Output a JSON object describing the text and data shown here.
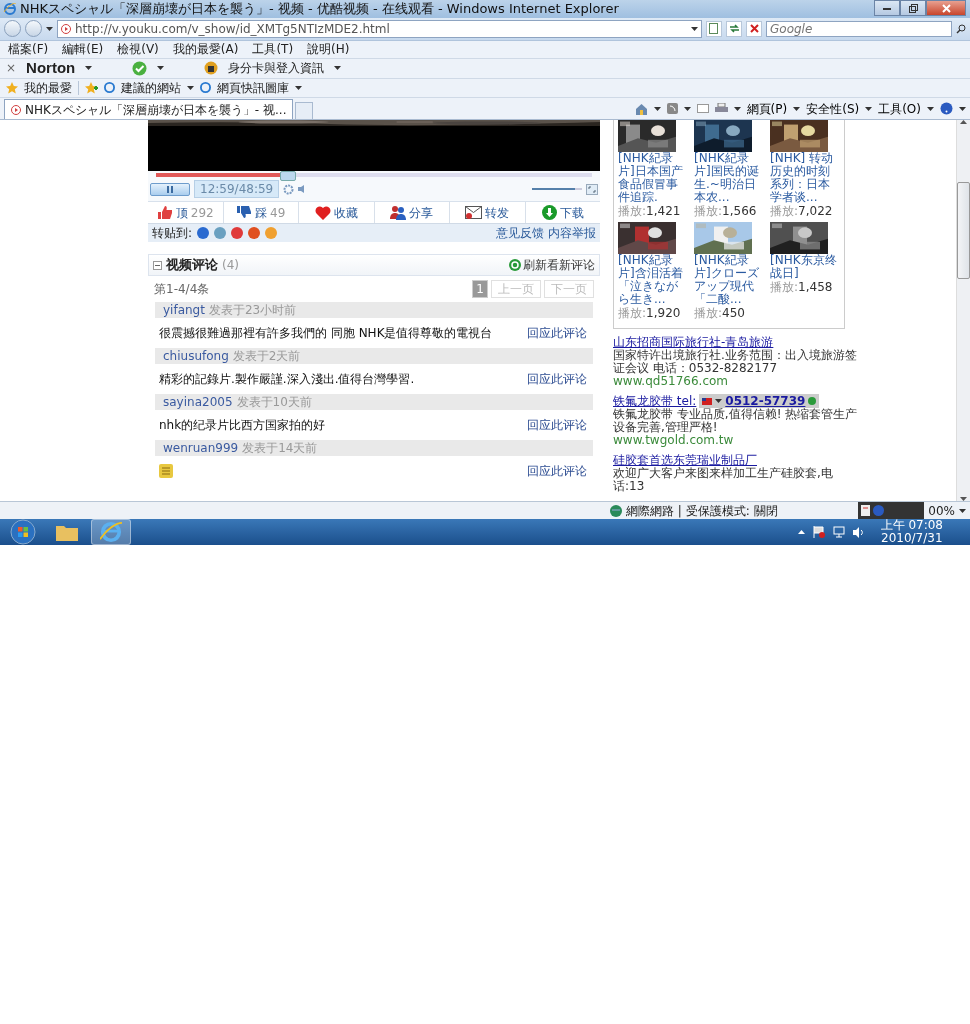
{
  "window": {
    "title": "NHKスペシャル「深層崩壊が日本を襲う」- 视频 - 优酷视频 - 在线观看 - Windows Internet Explorer"
  },
  "address": {
    "url": "http://v.youku.com/v_show/id_XMTg5NTIzMDE2.html"
  },
  "search": {
    "placeholder": "Google"
  },
  "menu": [
    "檔案(F)",
    "編輯(E)",
    "檢視(V)",
    "我的最愛(A)",
    "工具(T)",
    "說明(H)"
  ],
  "norton": {
    "close": "×",
    "brand": "Norton",
    "identity": "身分卡與登入資訊"
  },
  "favorites": {
    "label": "我的最愛",
    "items": [
      "建議的網站",
      "網頁快訊圖庫"
    ]
  },
  "tabs": [
    {
      "label": "NHKスペシャル「深層崩壊が日本を襲う」- 视...",
      "selected": true
    }
  ],
  "commands": [
    "網頁(P)",
    "安全性(S)",
    "工具(O)"
  ],
  "player": {
    "progress": {
      "level": 0.3
    },
    "time": "12:59/48:59",
    "volume": {
      "level": 0.85
    }
  },
  "actions": [
    {
      "kind": "like",
      "label": "顶",
      "count": "292"
    },
    {
      "kind": "dislike",
      "label": "踩",
      "count": "49"
    },
    {
      "kind": "favorite",
      "label": "收藏"
    },
    {
      "kind": "share",
      "label": "分享"
    },
    {
      "kind": "forward",
      "label": "转发"
    },
    {
      "kind": "download",
      "label": "下载"
    }
  ],
  "repost": {
    "label": "转贴到:",
    "links": [
      "意见反馈",
      "内容举报"
    ]
  },
  "comments": {
    "title": "视频评论",
    "count": "(4)",
    "refresh": "刷新看新评论",
    "range": "第1-4/4条",
    "pager": {
      "page": "1",
      "prev": "上一页",
      "next": "下一页"
    },
    "items": [
      {
        "kind": "text",
        "user": "yifangt",
        "time": "发表于23小时前",
        "text": "很震撼很難過那裡有許多我們的 同胞 NHK是值得尊敬的電視台",
        "reply": "回应此评论"
      },
      {
        "kind": "text",
        "user": "chiusufong",
        "time": "发表于2天前",
        "text": "精彩的記錄片.製作嚴謹.深入淺出.值得台灣學習.",
        "reply": "回应此评论"
      },
      {
        "kind": "text",
        "user": "sayina2005",
        "time": "发表于10天前",
        "text": "nhk的纪录片比西方国家拍的好",
        "reply": "回应此评论"
      },
      {
        "kind": "emoticon",
        "user": "wenruan999",
        "time": "发表于14天前",
        "reply": "回应此评论"
      }
    ]
  },
  "related": {
    "items": [
      {
        "title": "[NHK紀录片]日本国产食品假冒事件追踪.",
        "plays_label": "播放:",
        "plays": "1,421"
      },
      {
        "title": "[NHK紀录片]国民的诞生.~明治日本农...",
        "plays_label": "播放:",
        "plays": "1,566"
      },
      {
        "title": "[NHK] 转动历史的时刻系列：日本学者谈...",
        "plays_label": "播放:",
        "plays": "7,022"
      },
      {
        "title": "[NHK紀录片]含泪活着「泣きながら生き...",
        "plays_label": "播放:",
        "plays": "1,920"
      },
      {
        "title": "[NHK紀录片]クローズアップ現代「二酸...",
        "plays_label": "播放:",
        "plays": "450"
      },
      {
        "title": "[NHK东京终战日]",
        "plays_label": "播放:",
        "plays": "1,458"
      }
    ]
  },
  "ads": [
    {
      "title": "山东招商国际旅行社-青岛旅游",
      "desc": "国家特许出境旅行社.业务范围：出入境旅游签证会议 电话：0532-8282177",
      "url": "www.qd51766.com"
    },
    {
      "title": "铁氟龙胶带 tel:",
      "phone": "0512-57739",
      "desc": "铁氟龙胶带 专业品质,值得信赖! 热缩套管生产设备完善,管理严格!",
      "url": "www.twgold.com.tw"
    },
    {
      "title": "硅胶套首选东莞瑞业制品厂",
      "desc": "欢迎广大客户来图来样加工生产硅胶套,电话:13"
    }
  ],
  "status": {
    "zone": "網際網路 | 受保護模式: 關閉",
    "zoom": "00%"
  },
  "taskbar": {
    "time": "上午 07:08",
    "date": "2010/7/31"
  }
}
